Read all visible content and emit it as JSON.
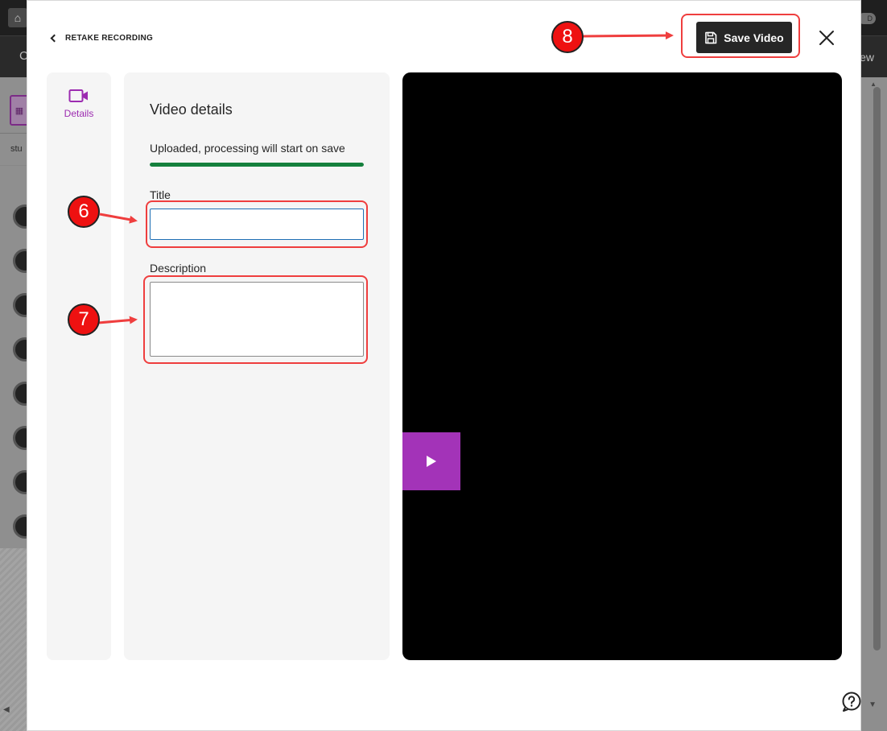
{
  "background_app": {
    "view_label": "ew",
    "nav_letter": "C",
    "pill_text": "D",
    "left_truncated_text": "stu"
  },
  "modal": {
    "retake_label": "RETAKE RECORDING",
    "save_label": "Save Video",
    "side_nav": {
      "details_label": "Details"
    },
    "details": {
      "heading": "Video details",
      "status_text": "Uploaded, processing will start on save",
      "progress_percent": 100,
      "title_label": "Title",
      "title_value": "",
      "description_label": "Description",
      "description_value": ""
    }
  },
  "annotations": {
    "step_title": "6",
    "step_description": "7",
    "step_save": "8",
    "color": "#ef3e3e"
  },
  "colors": {
    "accent": "#9c2bb0",
    "play_button": "#a333b8",
    "progress": "#15803d",
    "save_button": "#262626",
    "input_focus": "#1f6fb5"
  },
  "icons": {
    "back": "chevron-left-icon",
    "save": "floppy-disk-icon",
    "close": "close-icon",
    "details": "video-camera-icon",
    "play": "play-icon",
    "help": "help-icon"
  }
}
